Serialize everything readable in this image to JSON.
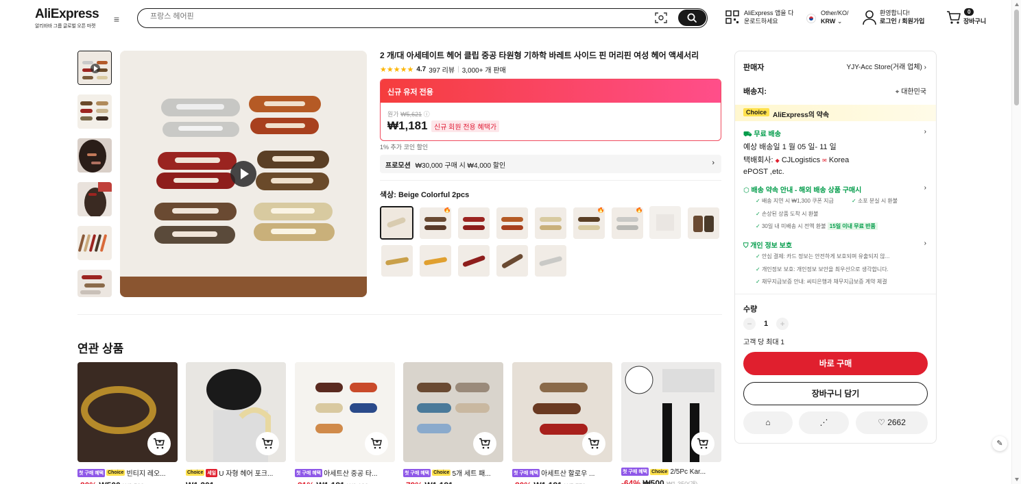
{
  "header": {
    "logo": "AliExpress",
    "logo_sub": "알리바바 그룹 글로벌 오픈 마켓",
    "search_placeholder": "프랑스 헤어핀",
    "app_line1": "AliExpress 앱을 다",
    "app_line2": "운로드하세요",
    "region_line1": "Other/KO/",
    "region_line2": "KRW",
    "account_line1": "환영합니다!",
    "account_line2": "로그인 / 회원가입",
    "cart_count": "0",
    "cart_label": "장바구니"
  },
  "product": {
    "title": "2 개/대 아세테이트 헤어 클립 중공 타원형 기하학 바레트 사이드 핀 머리핀 여성 헤어 액세서리",
    "rating": "4.7",
    "reviews": "397 리뷰",
    "sold": "3,000+ 개 판매",
    "new_user_banner": "신규 유저 전용",
    "original_label": "원가",
    "original_price": "₩5,621",
    "price": "₩1,181",
    "price_tag": "신규 회원 전용 혜택가",
    "coin_note": "1% 추가 코인 할인",
    "promo_label": "프로모션",
    "promo_text": "₩30,000 구매 시 ₩4,000 할인",
    "color_label": "색상: Beige Colorful 2pcs"
  },
  "panel": {
    "seller_label": "판매자",
    "seller_name": "YJY-Acc Store(거래 업체)",
    "ship_label": "배송지:",
    "ship_to": "대한민국",
    "choice_badge": "Choice",
    "choice_title": "AliExpress의 약속",
    "free_ship": "무료 배송",
    "delivery": "예상 배송일 1 월 05 일- 11 일",
    "carrier_label": "택배회사:",
    "carrier_1": "CJLogistics",
    "carrier_2": "Korea",
    "carrier_3": "ePOST ,etc.",
    "guarantee_title": "배송 약속 안내 - 해외 배송 상품 구매시",
    "g1": "배송 지연 시 ₩1,300 쿠폰 지급",
    "g2": "소포 분실 시 환불",
    "g3": "손상된 상품 도착 시 환불",
    "g4": "30일 내 미배송 시 전액 환불",
    "g4_tag": "15일 이내 무료 반품",
    "privacy_title": "개인 정보 보호",
    "p1": "안심 결제: 카드 정보는 안전하게 보호되며 유출되지 않...",
    "p2": "개인정보 보호: 개인정보 보안을 최우선으로 생각합니다.",
    "p3": "채무지급보증 안내: 씨티은행과 채무지급보증 계약 체결",
    "qty_label": "수량",
    "qty_value": "1",
    "qty_max": "고객 당 최대 1",
    "buy_now": "바로 구매",
    "add_cart": "장바구니 담기",
    "likes": "2662"
  },
  "related": {
    "title": "연관 상품",
    "items": [
      {
        "tags": [
          "첫 구매 혜택",
          "Choice"
        ],
        "name": "빈티지 레오...",
        "disc": "-80%",
        "price": "₩500",
        "old": "₩2,500"
      },
      {
        "tags": [
          "Choice",
          "세일"
        ],
        "name": "U 자형 헤어 포크...",
        "disc": "",
        "price": "₩1,301",
        "old": ""
      },
      {
        "tags": [
          "첫 구매 혜택"
        ],
        "name": "아세트산 중공 타...",
        "disc": "-81%",
        "price": "₩1,181",
        "old": "₩6,190"
      },
      {
        "tags": [
          "첫 구매 혜택",
          "Choice"
        ],
        "name": "5개 세트 패...",
        "disc": "-79%",
        "price": "₩1,181",
        "old": ""
      },
      {
        "tags": [
          "첫 구매 혜택"
        ],
        "name": "아세트산 할로우 ...",
        "disc": "-80%",
        "price": "₩1,181",
        "old": "₩5,770"
      },
      {
        "tags": [
          "첫 구매 혜택",
          "Choice"
        ],
        "name": "2/5Pc Kar...",
        "disc": "-64%",
        "price": "₩500",
        "old": "₩1,350(개)"
      }
    ]
  }
}
